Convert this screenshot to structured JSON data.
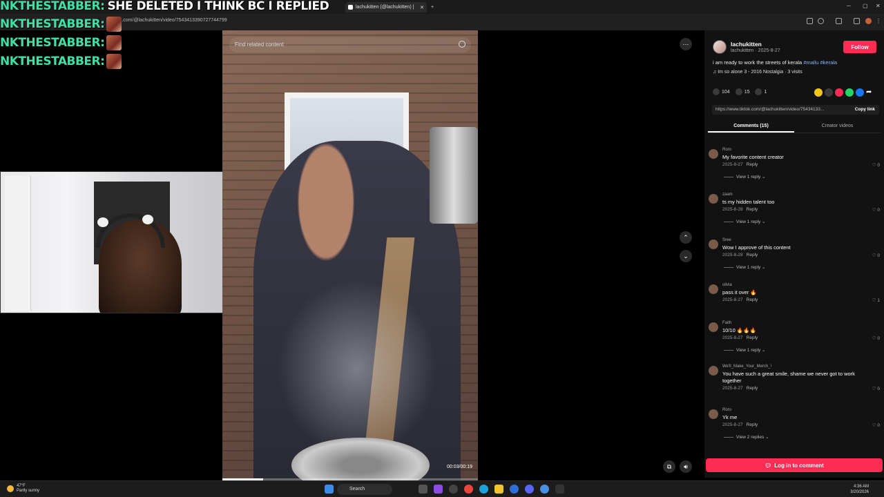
{
  "browser": {
    "tabs": [
      {
        "label": "lachukitten (@lachukitten) |",
        "active": true
      }
    ],
    "url": "tiktok.com/@lachukitten/video/7543413390727744799"
  },
  "chat": {
    "lines": [
      {
        "name": "NKTHESTABBER:",
        "message": "SHE DELETED I THINK BC I REPLIED"
      },
      {
        "name": "NKTHESTABBER:",
        "message": ""
      },
      {
        "name": "NKTHESTABBER:",
        "message": ""
      },
      {
        "name": "NKTHESTABBER:",
        "message": ""
      }
    ]
  },
  "video": {
    "search_placeholder": "Find related content",
    "timecode": "00:03/00:19",
    "progress": 0.16
  },
  "panel": {
    "username": "lachukitten",
    "subline": "lachukitten · 2025-8-27",
    "follow_label": "Follow",
    "description": "i am ready to work the streets of kerala",
    "hashtags": "#mallu #kerala",
    "music": "♫  Im so alone 3 - 2016 Nostalgia · 3 visits",
    "likes": "104",
    "comments_count": "15",
    "saves": "1",
    "link": "https://www.tiktok.com/@lachukitten/video/75434133...",
    "copy_link_label": "Copy link",
    "tab_comments": "Comments (15)",
    "tab_creator": "Creator videos",
    "share_colors": [
      "#f5c518",
      "#3a3a3a",
      "#fe2c55",
      "#25d366",
      "#1877f2"
    ],
    "accent": "#fe2c55"
  },
  "comments": [
    {
      "name": "Roro",
      "text": "My favorite content creator",
      "date": "2025-8-27",
      "reply": "Reply",
      "likes": "0",
      "view": "View 1 reply ⌄"
    },
    {
      "name": "zaam",
      "text": "ts my hidden talent too",
      "date": "2025-8-28",
      "reply": "Reply",
      "likes": "0",
      "view": "View 1 reply ⌄"
    },
    {
      "name": "Sree",
      "text": "Wow I approve of this content",
      "date": "2025-8-28",
      "reply": "Reply",
      "likes": "0",
      "view": "View 1 reply ⌄"
    },
    {
      "name": "olivia",
      "text": "pass it over 🔥",
      "date": "2025-8-27",
      "reply": "Reply",
      "likes": "1",
      "view": ""
    },
    {
      "name": "Faith",
      "text": "10/10 🔥🔥🔥",
      "date": "2025-8-27",
      "reply": "Reply",
      "likes": "0",
      "view": "View 1 reply ⌄"
    },
    {
      "name": "We'll_Make_Your_Merch_!",
      "text": "You have such a great smile, shame we never got to work together",
      "date": "2025-8-27",
      "reply": "Reply",
      "likes": "0",
      "view": ""
    },
    {
      "name": "Roro",
      "text": "Yk me",
      "date": "2025-8-27",
      "reply": "Reply",
      "likes": "0",
      "view": "View 2 replies ⌄"
    }
  ],
  "login_label": "Log in to comment",
  "taskbar": {
    "temp": "47°F",
    "weather": "Partly sunny",
    "search": "Search",
    "time": "4:36 AM",
    "date": "3/20/2026"
  }
}
